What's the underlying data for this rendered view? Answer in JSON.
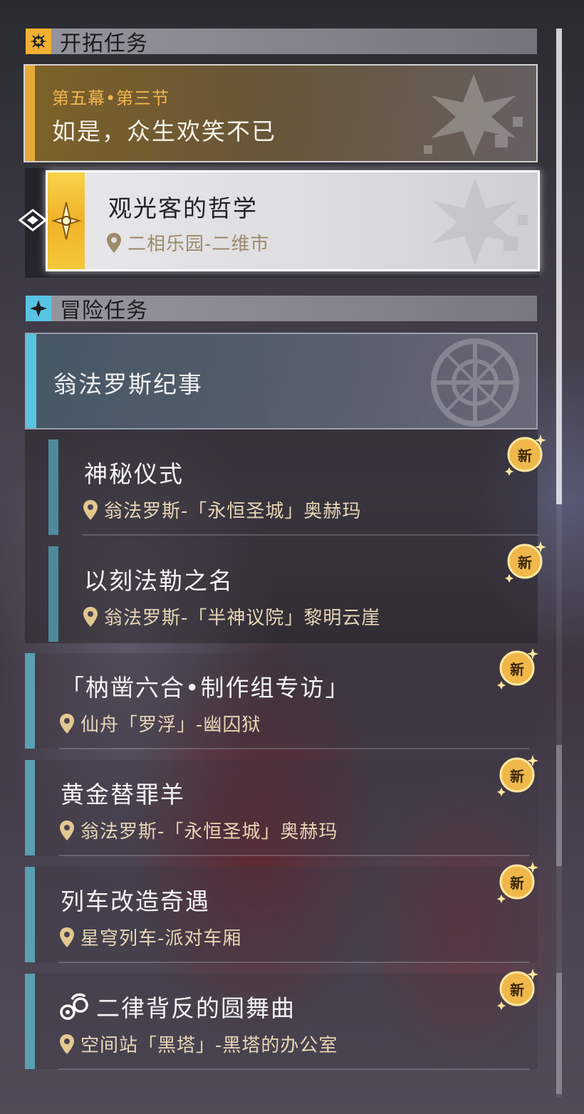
{
  "trailblaze_section": {
    "title": "开拓任务",
    "icon": "trailblaze-compass-icon",
    "accent": "#f0b030"
  },
  "main_quest": {
    "chapter": "第五幕•第三节",
    "title": "如是，众生欢笑不已"
  },
  "selected_quest": {
    "title": "观光客的哲学",
    "location": "二相乐园-二维市",
    "icon": "trailblaze-star-icon"
  },
  "adventure_section": {
    "title": "冒险任务",
    "icon": "adventure-star-icon",
    "accent": "#57c4e4"
  },
  "adventure_group": {
    "title": "翁法罗斯纪事"
  },
  "quests": [
    {
      "title": "神秘仪式",
      "location": "翁法罗斯-「永恒圣城」奥赫玛",
      "badge": "新"
    },
    {
      "title": "以刻法勒之名",
      "location": "翁法罗斯-「半神议院」黎明云崖",
      "badge": "新"
    },
    {
      "title": "「枘凿六合•制作组专访」",
      "location": "仙舟「罗浮」-幽囚狱",
      "badge": "新"
    },
    {
      "title": "黄金替罪羊",
      "location": "翁法罗斯-「永恒圣城」奥赫玛",
      "badge": "新"
    },
    {
      "title": "列车改造奇遇",
      "location": "星穹列车-派对车厢",
      "badge": "新"
    },
    {
      "title": "二律背反的圆舞曲",
      "location": "空间站「黑塔」-黑塔的办公室",
      "badge": "新",
      "icon": "herta-puppet-icon"
    }
  ],
  "colors": {
    "gold": "#f0b030",
    "cyan": "#57c4e4",
    "teal_bar": "#4d8a9d",
    "location_text": "#e8d6b6"
  }
}
